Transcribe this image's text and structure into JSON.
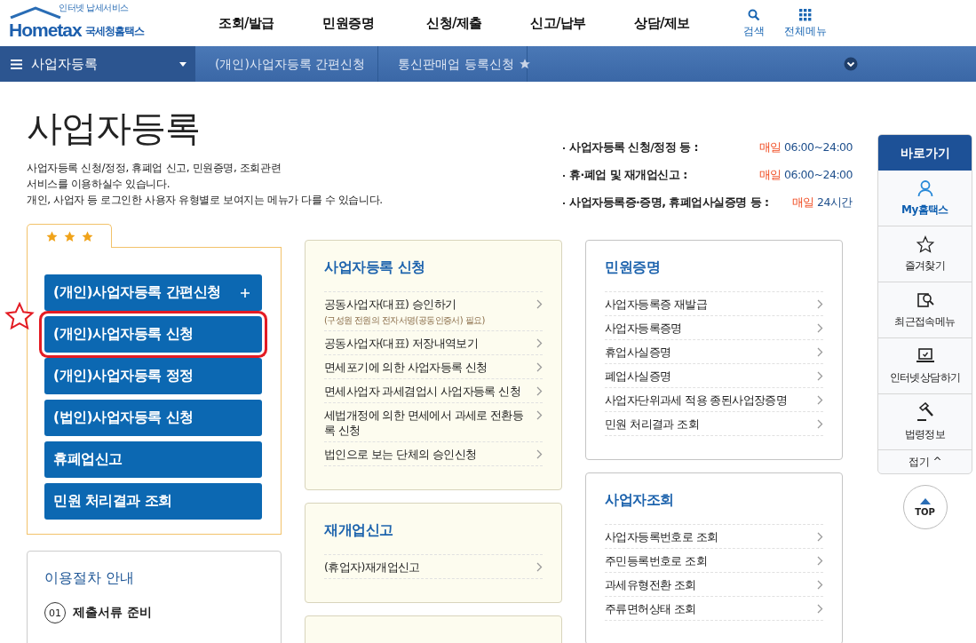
{
  "logo": {
    "tagline": "인터넷 납세서비스",
    "brand": "Hometax",
    "agency": "국세청홈택스"
  },
  "main_menu": [
    "조회/발급",
    "민원증명",
    "신청/제출",
    "신고/납부",
    "상담/제보"
  ],
  "header_tools": [
    {
      "kind": "search",
      "label": "검색"
    },
    {
      "kind": "grid",
      "label": "전체메뉴"
    }
  ],
  "breadcrumb": {
    "menu": "사업자등록",
    "trail": [
      "(개인)사업자등록 간편신청",
      "통신판매업 등록신청"
    ]
  },
  "page": {
    "title": "사업자등록",
    "description": [
      "사업자등록 신청/정정, 휴폐업 신고, 민원증명, 조회관련",
      "서비스를 이용하실수 있습니다.",
      "개인, 사업자 등 로그인한 사용자 유형별로 보여지는 메뉴가 다를 수 있습니다."
    ]
  },
  "hours": [
    {
      "label": "사업자등록 신청/정정 등 :",
      "day": "매일",
      "time": "06:00~24:00"
    },
    {
      "label": "휴·폐업 및 재개업신고 :",
      "day": "매일",
      "time": "06:00~24:00"
    },
    {
      "label": "사업자등록증·증명, 휴폐업사실증명 등 :",
      "day": "매일",
      "time": "24시간"
    }
  ],
  "favorites_tab": {
    "stars": 3
  },
  "quick_buttons": [
    {
      "label": "(개인)사업자등록 간편신청",
      "expandable": true,
      "annotated": false
    },
    {
      "label": "(개인)사업자등록 신청",
      "expandable": false,
      "annotated": true
    },
    {
      "label": "(개인)사업자등록 정정",
      "expandable": false,
      "annotated": false
    },
    {
      "label": "(법인)사업자등록 신청",
      "expandable": false,
      "annotated": false
    },
    {
      "label": "휴폐업신고",
      "expandable": false,
      "annotated": false
    },
    {
      "label": "민원 처리결과 조회",
      "expandable": false,
      "annotated": false
    }
  ],
  "guide": {
    "title": "이용절차 안내",
    "steps": [
      {
        "number": "01",
        "label": "제출서류 준비"
      }
    ]
  },
  "columns": [
    {
      "cards": [
        {
          "kind": "list",
          "title": "사업자등록 신청",
          "tinted": true,
          "items": [
            {
              "label": "공동사업자(대표) 승인하기",
              "note": "(구성원 전원의 전자서명(공동인증서) 필요)"
            },
            {
              "label": "공동사업자(대표) 저장내역보기"
            },
            {
              "label": "면세포기에 의한 사업자등록 신청"
            },
            {
              "label": "면세사업자 과세겸업시 사업자등록 신청"
            },
            {
              "label": "세법개정에 의한 면세에서 과세로 전환등록 신청"
            },
            {
              "label": "법인으로 보는 단체의 승인신청"
            }
          ]
        },
        {
          "kind": "list",
          "title": "재개업신고",
          "tinted": true,
          "items": [
            {
              "label": "(휴업자)재개업신고"
            }
          ]
        },
        {
          "kind": "empty",
          "tinted": true
        }
      ]
    },
    {
      "cards": [
        {
          "kind": "list",
          "title": "민원증명",
          "tinted": false,
          "items": [
            {
              "label": "사업자등록증 재발급"
            },
            {
              "label": "사업자등록증명"
            },
            {
              "label": "휴업사실증명"
            },
            {
              "label": "폐업사실증명"
            },
            {
              "label": "사업자단위과세 적용 종된사업장증명"
            },
            {
              "label": "민원 처리결과 조회"
            }
          ]
        },
        {
          "kind": "list",
          "title": "사업자조회",
          "tinted": false,
          "items": [
            {
              "label": "사업자등록번호로 조회"
            },
            {
              "label": "주민등록번호로 조회"
            },
            {
              "label": "과세유형전환 조회"
            },
            {
              "label": "주류면허상태 조회"
            }
          ]
        }
      ]
    }
  ],
  "shortcuts": {
    "title": "바로가기",
    "items": [
      {
        "kind": "user",
        "label": "My홈택스",
        "highlighted": true
      },
      {
        "kind": "star",
        "label": "즐겨찾기",
        "highlighted": false
      },
      {
        "kind": "recent",
        "label": "최근접속메뉴",
        "highlighted": false
      },
      {
        "kind": "laptop",
        "label": "인터넷상담하기",
        "highlighted": false
      },
      {
        "kind": "gavel",
        "label": "법령정보",
        "highlighted": false
      }
    ],
    "collapse": "접기 ^",
    "top": "TOP"
  }
}
